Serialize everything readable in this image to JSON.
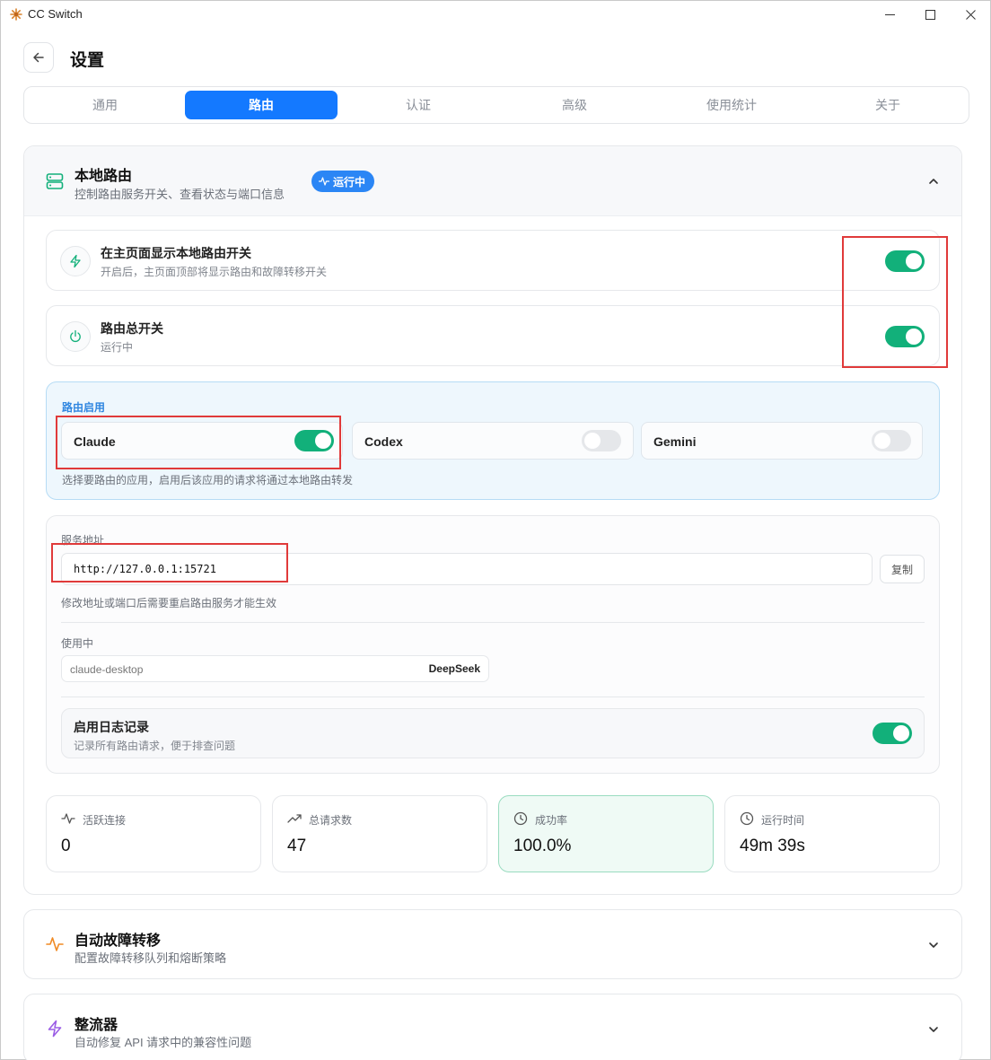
{
  "window": {
    "title": "CC Switch"
  },
  "header": {
    "title": "设置"
  },
  "tabs": [
    {
      "label": "通用",
      "active": false
    },
    {
      "label": "路由",
      "active": true
    },
    {
      "label": "认证",
      "active": false
    },
    {
      "label": "高级",
      "active": false
    },
    {
      "label": "使用统计",
      "active": false
    },
    {
      "label": "关于",
      "active": false
    }
  ],
  "local_router": {
    "title": "本地路由",
    "description": "控制路由服务开关、查看状态与端口信息",
    "status_badge": "运行中",
    "show_toggle": {
      "title": "在主页面显示本地路由开关",
      "subtitle": "开启后，主页面顶部将显示路由和故障转移开关",
      "on": true
    },
    "master_switch": {
      "title": "路由总开关",
      "subtitle": "运行中",
      "on": true
    },
    "routing_enabled": {
      "label": "路由启用",
      "apps": [
        {
          "name": "Claude",
          "on": true
        },
        {
          "name": "Codex",
          "on": false
        },
        {
          "name": "Gemini",
          "on": false
        }
      ],
      "note": "选择要路由的应用，启用后该应用的请求将通过本地路由转发"
    },
    "service": {
      "address_label": "服务地址",
      "address": "http://127.0.0.1:15721",
      "copy_label": "复制",
      "address_note": "修改地址或端口后需要重启路由服务才能生效",
      "in_use_label": "使用中",
      "in_use_name": "claude-desktop",
      "in_use_provider": "DeepSeek",
      "logging": {
        "title": "启用日志记录",
        "subtitle": "记录所有路由请求，便于排查问题",
        "on": true
      }
    },
    "stats": [
      {
        "label": "活跃连接",
        "value": "0",
        "icon": "activity-icon"
      },
      {
        "label": "总请求数",
        "value": "47",
        "icon": "trending-up-icon"
      },
      {
        "label": "成功率",
        "value": "100.0%",
        "icon": "clock-icon"
      },
      {
        "label": "运行时间",
        "value": "49m 39s",
        "icon": "clock-icon"
      }
    ]
  },
  "failover": {
    "title": "自动故障转移",
    "description": "配置故障转移队列和熔断策略"
  },
  "rectifier": {
    "title": "整流器",
    "description": "自动修复 API 请求中的兼容性问题"
  },
  "colors": {
    "accent": "#1479ff",
    "toggle_on": "#12b07a",
    "highlight": "#e03a3a",
    "failover_icon": "#f08a24",
    "rectifier_icon": "#9b5de5"
  }
}
